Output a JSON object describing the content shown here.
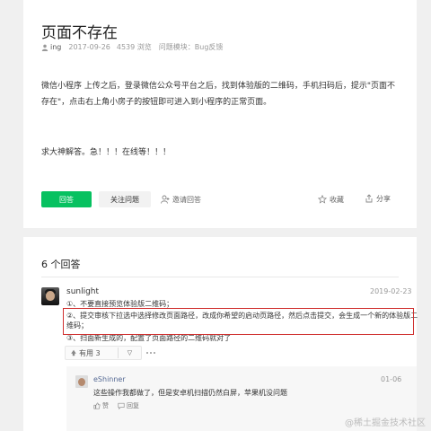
{
  "question": {
    "title": "页面不存在",
    "author": "ing",
    "date": "2017-09-26",
    "views": "4539 浏览",
    "module": "问题模块：Bug反馈",
    "body": "微信小程序 上传之后，登录微信公众号平台之后，找到体验版的二维码，手机扫码后，提示\"页面不存在\"，点击右上角小房子的按钮即可进入到小程序的正常页面。",
    "body2": "求大神解答。急！！！在线等！！！"
  },
  "actions": {
    "answer_label": "回答",
    "follow_label": "关注问题",
    "invite_label": "邀请回答",
    "collect_label": "收藏",
    "share_label": "分享"
  },
  "answers": {
    "count_label": "6 个回答",
    "items": [
      {
        "user": "sunlight",
        "date": "2019-02-23",
        "lines": [
          "①、不要直接预览体验版二维码；",
          "②、提交审核下拉选中选择修改页面路径，改成你希望的启动页路径，然后点击提交，会生成一个新的体验版二",
          "维码；",
          "③、扫面新生成的，配置了页面路径的二维码就对了"
        ],
        "useful_label": "有用 3",
        "down_label": "▽"
      }
    ]
  },
  "reply": {
    "user": "eShinner",
    "date": "01-06",
    "text": "这些操作我都做了，但是安卓机扫描仍然白屏，苹果机没问题",
    "like_label": "赞",
    "reply_label": "回复"
  },
  "watermark": "@稀土掘金技术社区",
  "colors": {
    "accent": "#07c160",
    "highlight": "#d0302f",
    "link": "#576b95"
  }
}
